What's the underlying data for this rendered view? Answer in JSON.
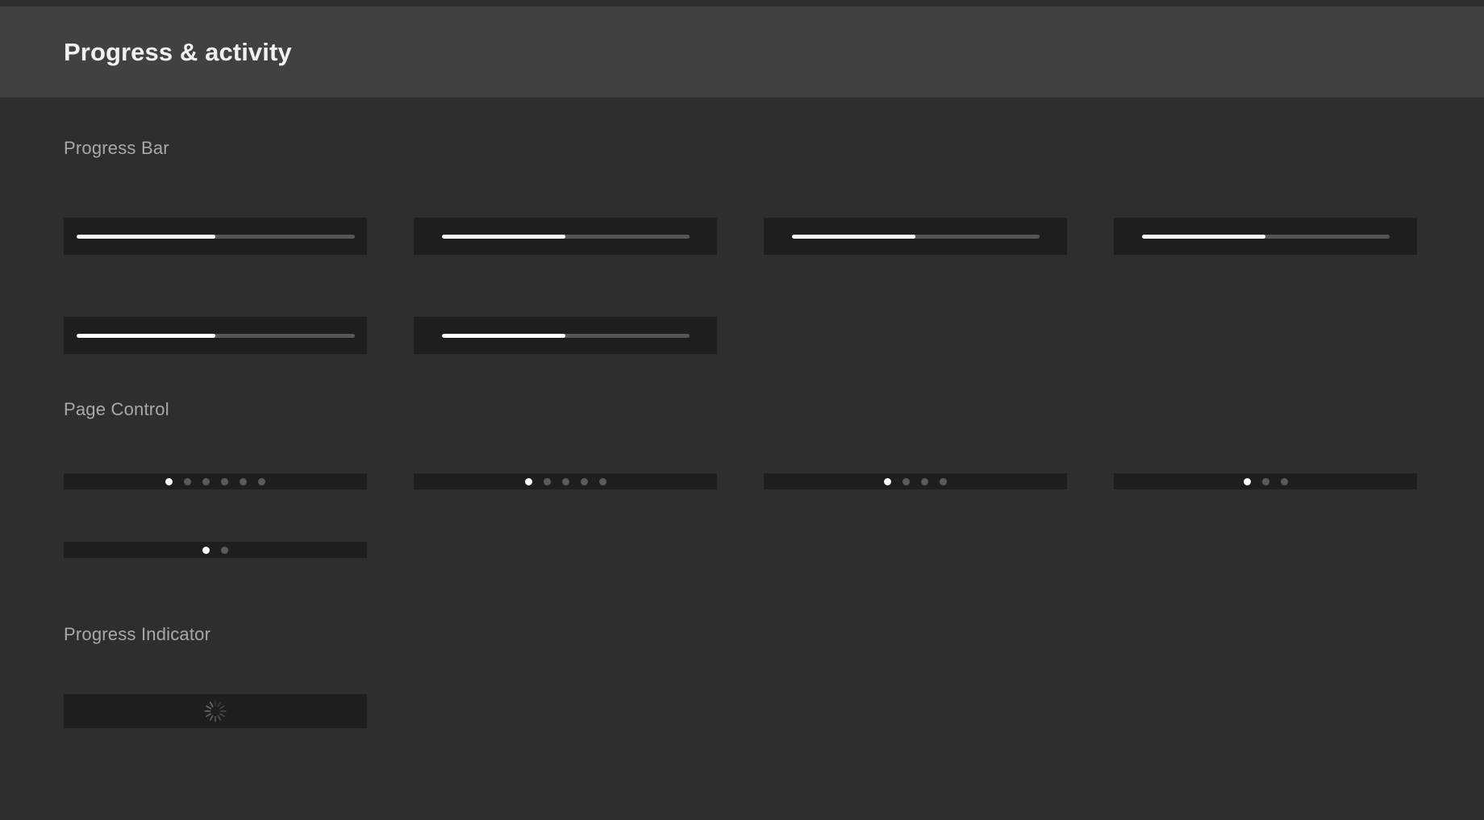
{
  "window": {
    "background_color": "#2e2e2e",
    "header_background_color": "#414141",
    "card_background_color": "#1e1e1e"
  },
  "header": {
    "title": "Progress & activity"
  },
  "sections": [
    {
      "id": "progress-bar",
      "title": "Progress Bar"
    },
    {
      "id": "page-control",
      "title": "Page Control"
    },
    {
      "id": "progress-indicator",
      "title": "Progress Indicator"
    }
  ],
  "progress_bars": {
    "accent_color": "#ffffff",
    "track_color": "#565656",
    "row1": [
      {
        "name": "progress-bar-1",
        "value": 50,
        "max": 100
      },
      {
        "name": "progress-bar-2",
        "value": 50,
        "max": 100
      },
      {
        "name": "progress-bar-3",
        "value": 50,
        "max": 100
      },
      {
        "name": "progress-bar-4",
        "value": 50,
        "max": 100
      }
    ],
    "row2": [
      {
        "name": "progress-bar-5",
        "value": 50,
        "max": 100
      },
      {
        "name": "progress-bar-6",
        "value": 50,
        "max": 100
      }
    ]
  },
  "page_controls": {
    "active_dot_color": "#ffffff",
    "inactive_dot_color": "#5b5b5b",
    "row1": [
      {
        "name": "page-control-1",
        "pages": 6,
        "current_page": 1
      },
      {
        "name": "page-control-2",
        "pages": 5,
        "current_page": 1
      },
      {
        "name": "page-control-3",
        "pages": 4,
        "current_page": 1
      },
      {
        "name": "page-control-4",
        "pages": 3,
        "current_page": 1
      }
    ],
    "row2": [
      {
        "name": "page-control-5",
        "pages": 2,
        "current_page": 1
      }
    ]
  },
  "progress_indicator": {
    "name": "activity-spinner",
    "style": "radial-spokes",
    "spokes": 12,
    "color": "#6f6f6f"
  }
}
